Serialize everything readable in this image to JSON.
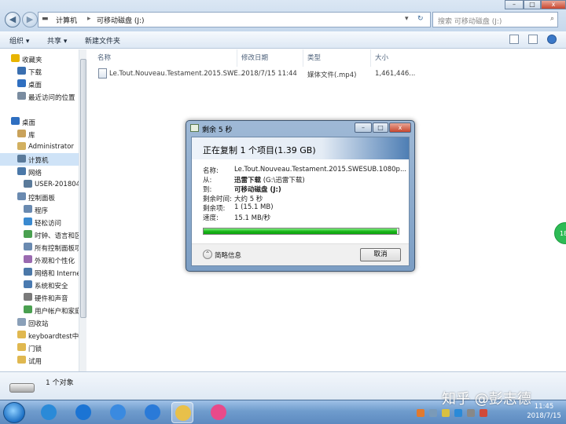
{
  "window": {
    "address_segments": [
      "计算机",
      "可移动磁盘 (J:)"
    ],
    "search_placeholder": "搜索 可移动磁盘 (J:)",
    "back_glyph": "◀",
    "forward_glyph": "▶"
  },
  "toolbar": {
    "organize": "组织 ▾",
    "share": "共享 ▾",
    "new_folder": "新建文件夹"
  },
  "sidebar": {
    "items": [
      {
        "label": "收藏夹",
        "icon": "star-icon",
        "color": "#e8b400"
      },
      {
        "label": "下载",
        "icon": "download-folder-icon",
        "color": "#3a6fb0"
      },
      {
        "label": "桌面",
        "icon": "desktop-icon",
        "color": "#2f6fc0"
      },
      {
        "label": "最近访问的位置",
        "icon": "recent-places-icon",
        "color": "#7a8ca0"
      },
      {
        "label": "桌面",
        "icon": "desktop-icon",
        "color": "#2f6fc0"
      },
      {
        "label": "库",
        "icon": "libraries-icon",
        "color": "#c9a25a"
      },
      {
        "label": "Administrator",
        "icon": "user-folder-icon",
        "color": "#d2b060"
      },
      {
        "label": "计算机",
        "icon": "computer-icon",
        "color": "#5a7a9a"
      },
      {
        "label": "网络",
        "icon": "network-icon",
        "color": "#4b78a8"
      },
      {
        "label": "USER-2018041",
        "icon": "pc-icon",
        "color": "#5a7a9a"
      },
      {
        "label": "控制面板",
        "icon": "control-panel-icon",
        "color": "#6a8ab0"
      },
      {
        "label": "程序",
        "icon": "programs-icon",
        "color": "#6a8ab0"
      },
      {
        "label": "轻松访问",
        "icon": "ease-of-access-icon",
        "color": "#3a8ad0"
      },
      {
        "label": "时钟、语言和区",
        "icon": "clock-language-icon",
        "color": "#4aa050"
      },
      {
        "label": "所有控制面板项",
        "icon": "all-cp-items-icon",
        "color": "#6a8ab0"
      },
      {
        "label": "外观和个性化",
        "icon": "appearance-icon",
        "color": "#9a6ab0"
      },
      {
        "label": "网络和 Internet",
        "icon": "network-internet-icon",
        "color": "#4b78a8"
      },
      {
        "label": "系统和安全",
        "icon": "system-security-icon",
        "color": "#4a7ab0"
      },
      {
        "label": "硬件和声音",
        "icon": "hardware-sound-icon",
        "color": "#7a7a7a"
      },
      {
        "label": "用户帐户和家庭",
        "icon": "user-accounts-icon",
        "color": "#4aa050"
      },
      {
        "label": "回收站",
        "icon": "recycle-bin-icon",
        "color": "#8aa0b8"
      },
      {
        "label": "keyboardtest中",
        "icon": "folder-icon",
        "color": "#e0b850"
      },
      {
        "label": "门锁",
        "icon": "folder-icon",
        "color": "#e0b850"
      },
      {
        "label": "试用",
        "icon": "folder-icon",
        "color": "#e0b850"
      }
    ]
  },
  "file_list": {
    "columns": [
      "名称",
      "修改日期",
      "类型",
      "大小"
    ],
    "rows": [
      {
        "name": "Le.Tout.Nouveau.Testament.2015.SWE...",
        "modified": "2018/7/15 11:44",
        "type": "媒体文件(.mp4)",
        "size": "1,461,446..."
      }
    ]
  },
  "details": {
    "count": "1 个对象"
  },
  "dialog": {
    "title": "剩余 5 秒",
    "heading": "正在复制 1 个项目(1.39 GB)",
    "rows": [
      {
        "label": "名称:",
        "value": "Le.Tout.Nouveau.Testament.2015.SWESUB.1080p...",
        "bold": false
      },
      {
        "label": "从:",
        "value": "迅雷下载",
        "extra": " (G:\\迅雷下载)",
        "bold": true
      },
      {
        "label": "到:",
        "value": "可移动磁盘 (J:)",
        "extra": "",
        "bold": true
      },
      {
        "label": "剩余时间:",
        "value": "大约 5 秒",
        "extra": "",
        "bold": false
      },
      {
        "label": "剩余项:",
        "value": "1 (15.1 MB)",
        "extra": "",
        "bold": false
      },
      {
        "label": "速度:",
        "value": "15.1 MB/秒",
        "extra": "",
        "bold": false
      }
    ],
    "progress": 0.99,
    "less_info": "简略信息",
    "cancel": "取消",
    "ctl_min": "–",
    "ctl_max": "□",
    "ctl_close": "x"
  },
  "badge": "18",
  "taskbar": {
    "apps": [
      {
        "icon": "browser-icon",
        "color": "#2a8ad8"
      },
      {
        "icon": "k-app-icon",
        "color": "#1b74d4"
      },
      {
        "icon": "bird-app-icon",
        "color": "#3a8ae0"
      },
      {
        "icon": "baidu-netdisk-icon",
        "color": "#2a7ad8"
      },
      {
        "icon": "file-explorer-icon",
        "color": "#e8c04a"
      },
      {
        "icon": "color-wheel-icon",
        "color": "#e84a8a"
      }
    ],
    "clock_time": "11:45",
    "clock_date": "2018/7/15"
  },
  "watermark": "知乎 @彭志德"
}
